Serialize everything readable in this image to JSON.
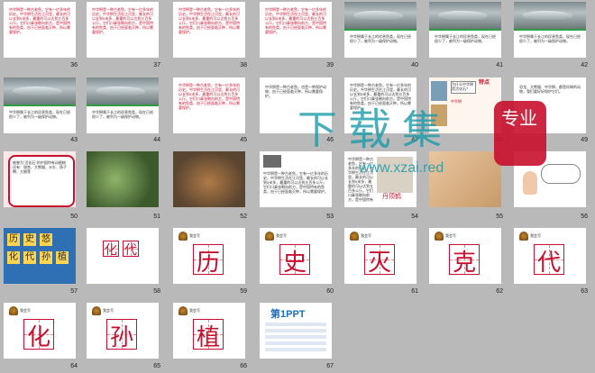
{
  "numbers": [
    "36",
    "37",
    "38",
    "39",
    "40",
    "41",
    "42",
    "43",
    "44",
    "45",
    "46",
    "47",
    "48",
    "49",
    "50",
    "51",
    "52",
    "53",
    "54",
    "55",
    "56",
    "57",
    "58",
    "59",
    "60",
    "61",
    "62",
    "63",
    "64",
    "65",
    "66",
    "67"
  ],
  "para_text": "中华鲟是一种古老鱼，它有一亿多年的历史。中华鲟生活在江河里，最长的可以长到5米多，最重的可以达到五百多公斤。它们口鼻张朝向前方，是中国特有的鱼类，由于已经面临灭种，所以需要保护。",
  "sturgeon_caption": "中华鲟属于长江的珍贵鱼类，现在已经很少了，被列为一级保护动物。",
  "slide46_text": "中华鲟是一种古老鱼，也是一种保护动物，由于已经面临灭种，所以需要保护。",
  "slide48": {
    "t1": "为什么中华鲟是活化石？",
    "t2": "特点",
    "t3": "中华鲟"
  },
  "slide49_text": "恐龙、大熊猫、中华鲟，都是珍稀的动物，我们要好好保护它们。",
  "slide50_text": "被誉为\"活化石\"的中国特有动植物还有：银杏、大熊猫、水杉、扬子鳄、大鲵等",
  "slide55": {
    "label": "丹顶鹤"
  },
  "chars_57": [
    "历",
    "史",
    "悠",
    "化",
    "代",
    "孙",
    "植"
  ],
  "slide58_chars": [
    "化",
    "代"
  ],
  "writing_chars": [
    "历",
    "史",
    "灭",
    "克",
    "代",
    "化",
    "孙",
    "植"
  ],
  "tag_label": "我会写",
  "watermark": {
    "big1": "下",
    "big2": "载",
    "big3": "集",
    "pro": "专业",
    "url": "www.xzai.red"
  },
  "slide67": {
    "brand": "第1PPT"
  },
  "colors": {
    "accent_red": "#c8102e",
    "green": "#2e9e44",
    "teal": "#1b9aa8"
  }
}
